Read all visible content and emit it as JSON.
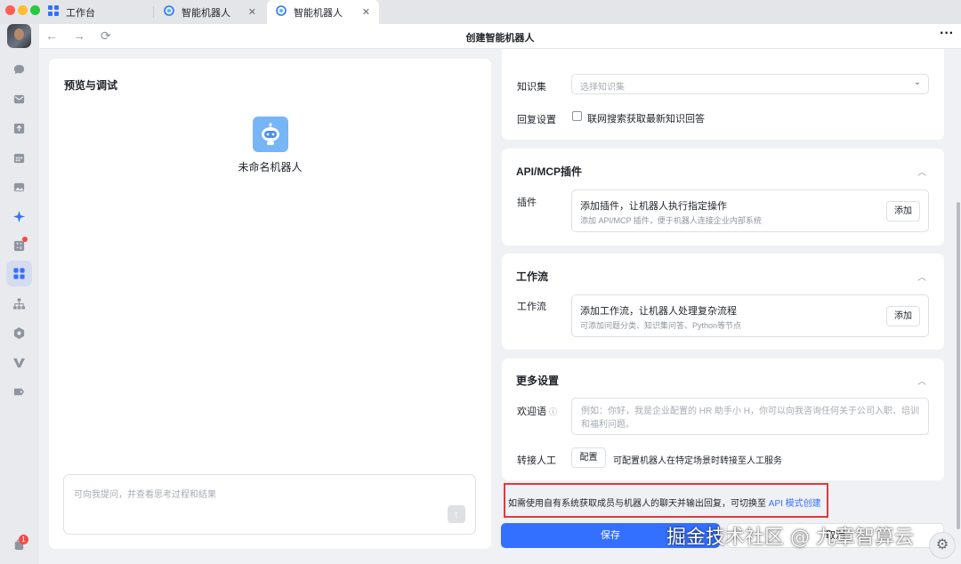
{
  "tabs": [
    {
      "label": "工作台",
      "icon": "grid-app-icon"
    },
    {
      "label": "智能机器人",
      "icon": "bot-app-icon"
    },
    {
      "label": "智能机器人",
      "icon": "bot-app-icon",
      "active": true
    }
  ],
  "navbar": {
    "title": "创建智能机器人",
    "more": "···"
  },
  "rail": {
    "items": [
      {
        "icon": "chat-icon"
      },
      {
        "icon": "mail-icon"
      },
      {
        "icon": "upload-icon"
      },
      {
        "icon": "calendar-icon"
      },
      {
        "icon": "image-icon"
      },
      {
        "icon": "sparkle-icon"
      },
      {
        "icon": "calculator-icon",
        "dot": true
      },
      {
        "icon": "apps-grid-icon",
        "active": true
      },
      {
        "icon": "org-chart-icon"
      },
      {
        "icon": "hexagon-icon"
      },
      {
        "icon": "v-logo-icon"
      },
      {
        "icon": "tag-icon"
      }
    ],
    "bottom_badge": "1"
  },
  "preview": {
    "title": "预览与调试",
    "bot_name": "未命名机器人",
    "input_placeholder": "可向我提问，并查看思考过程和结果",
    "send_symbol": "↑"
  },
  "knowledge": {
    "label": "知识集",
    "select_placeholder": "选择知识集",
    "reply_label": "回复设置",
    "reply_checkbox": "联网搜索获取最新知识回答",
    "reply_checked": false
  },
  "plugins": {
    "title": "API/MCP插件",
    "label": "插件",
    "main_text": "添加插件，让机器人执行指定操作",
    "sub_text": "添加 API/MCP 插件，便于机器人连接企业内部系统",
    "button": "添加"
  },
  "workflow": {
    "title": "工作流",
    "label": "工作流",
    "main_text": "添加工作流，让机器人处理复杂流程",
    "sub_text": "可添加问题分类、知识集问答、Python等节点",
    "button": "添加"
  },
  "more": {
    "title": "更多设置",
    "welcome_label": "欢迎语",
    "welcome_placeholder": "例如：你好，我是企业配置的 HR 助手小 H，你可以向我咨询任何关于公司入职、培训和福利问题。",
    "handoff_label": "转接人工",
    "handoff_button": "配置",
    "handoff_desc": "可配置机器人在特定场景时转接至人工服务"
  },
  "note": {
    "text": "如需使用自有系统获取成员与机器人的聊天并输出回复，可切换至",
    "link": "API 模式创建"
  },
  "footer": {
    "save": "保存",
    "cancel": "取消"
  },
  "watermark": "掘金技术社区 @ 九章智算云",
  "colors": {
    "accent": "#3370ff",
    "highlight_border": "#e0393e",
    "bot_avatar": "#76b6f7"
  }
}
